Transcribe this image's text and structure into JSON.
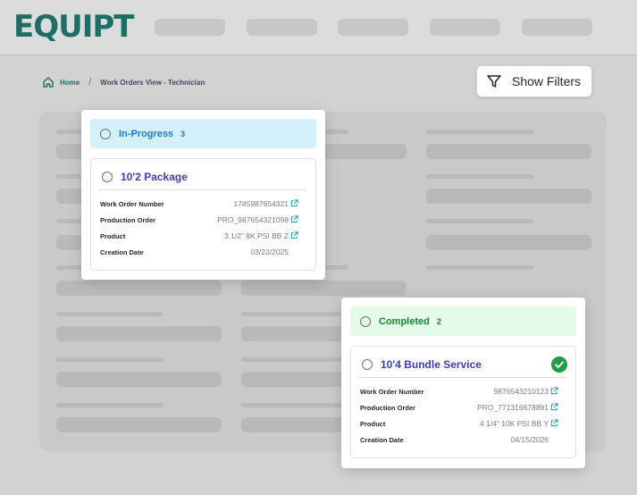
{
  "app": {
    "logo": "EQUIPT"
  },
  "breadcrumb": {
    "home": "Home",
    "separator": "/",
    "current": "Work Orders View - Technician"
  },
  "toolbar": {
    "show_filters": "Show Filters"
  },
  "columns": [
    {
      "status": "In-Progress",
      "count": "3",
      "header_bg": "#d3f0fb",
      "header_fg": "#1e7bc2",
      "order": {
        "title": "10'2 Package",
        "completed": false,
        "fields": [
          {
            "label": "Work Order Number",
            "value": "1785987654321"
          },
          {
            "label": "Production Order",
            "value": "PRO_987654321098"
          },
          {
            "label": "Product",
            "value": "3 1/2\" 8K PSI BB Z"
          },
          {
            "label": "Creation Date",
            "value": "03/22/2025"
          }
        ]
      }
    },
    {
      "status": "Completed",
      "count": "2",
      "header_bg": "#e3fbe8",
      "header_fg": "#17853a",
      "order": {
        "title": "10'4 Bundle Service",
        "completed": true,
        "fields": [
          {
            "label": "Work Order Number",
            "value": "9876543210123"
          },
          {
            "label": "Production Order",
            "value": "PRO_771316678891"
          },
          {
            "label": "Product",
            "value": "4 1/4\" 10K PSI BB Y"
          },
          {
            "label": "Creation Date",
            "value": "04/15/2026"
          }
        ]
      }
    }
  ],
  "colors": {
    "brand": "#1e6e68",
    "title_blue": "#3d3fb0",
    "link_teal": "#1a9aa6",
    "success": "#1e9e4a"
  },
  "icons": {
    "home": "home-icon",
    "filter": "filter-icon",
    "external": "external-link-icon",
    "check": "check-circle-icon"
  }
}
